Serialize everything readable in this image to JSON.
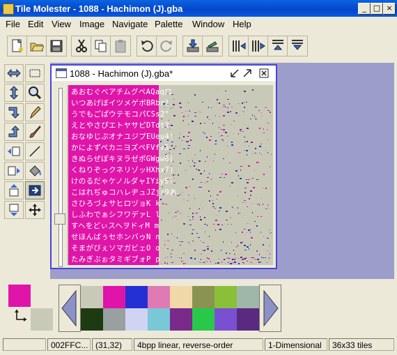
{
  "app": {
    "title": "Tile Molester - 1088 - Hachimon (J).gba"
  },
  "menu": [
    "File",
    "Edit",
    "View",
    "Image",
    "Navigate",
    "Palette",
    "Window",
    "Help"
  ],
  "toolbar": [
    "new-file-icon",
    "open-file-icon",
    "save-icon",
    "cut-icon",
    "copy-icon",
    "paste-icon",
    "undo-icon",
    "redo-icon",
    "import-icon",
    "export-icon",
    "decrease-width-icon",
    "increase-width-icon",
    "decrease-height-icon",
    "increase-height-icon"
  ],
  "document": {
    "title": "1088 - Hachimon (J).gba*",
    "glyph_rows": [
      "あおむぐべアチムグペAQaqロ",
      "いつあげぼイツメゲボBRbr1",
      "うでもごぱウテモコパCSs2\"",
      "えとやさぴエトヤサピDTdt3,",
      "おなゆじぷオナユジプEUeu4!",
      "かによずぺカニヨズペFVfv5",
      "きぬらぜぽキヌラゼポGWgw6(",
      "くねりぞっクネリゾッHXhx7)",
      "けのるだゃケノルダャIYiy8?",
      "こはれぢゅコハレヂュJZjz9あ",
      "さひろづょサヒロヅョK k  ",
      "しふわでぁシフワデァL l  ",
      "すへをどぃスヘヲドィM m  ",
      "せほんばぅセホンバゥN n  ",
      "そまがびぇソマガビェO o  ",
      "たみぎぶぉタミギブォP p  "
    ]
  },
  "colors": {
    "fg": "#e014a8",
    "bg": "#c8cab7",
    "palette": [
      "#c8cab7",
      "#e014a8",
      "#2430d4",
      "#e07ab5",
      "#f0d8a8",
      "#8a9450",
      "#8abf3a",
      "#9fb7a8",
      "#1e3a12",
      "#98a0a0",
      "#d0d4f2",
      "#78c8d8",
      "#7a2a8a",
      "#28c84a",
      "#7a50d2",
      "#5a2a80"
    ]
  },
  "status": {
    "offset": "002FFC...",
    "coords": "(31,32)",
    "codec": "4bpp linear, reverse-order",
    "mode": "1-Dimensional",
    "size": "36x33 tiles"
  }
}
